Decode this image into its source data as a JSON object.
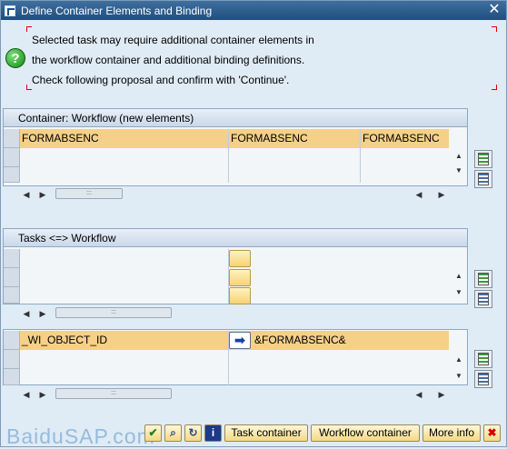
{
  "window": {
    "title": "Define Container Elements and Binding"
  },
  "message": {
    "lines": [
      "Selected task may require additional container elements in",
      "the workflow container and additional binding definitions.",
      "Check following proposal and confirm with 'Continue'."
    ]
  },
  "panel1": {
    "title": "Container: Workflow (new elements)",
    "row1": [
      "FORMABSENC",
      "FORMABSENC",
      "FORMABSENC"
    ]
  },
  "panel2": {
    "title": "Tasks <=> Workflow"
  },
  "panel3": {
    "row1_left": "_WI_OBJECT_ID",
    "row1_right": "&FORMABSENC&"
  },
  "footer": {
    "task_container": "Task container",
    "workflow_container": "Workflow container",
    "more_info": "More info",
    "watermark": "BaiduSAP.com"
  },
  "icons": {
    "help": "help-icon",
    "close": "close-icon",
    "continue": "check-icon",
    "find": "find-icon",
    "refresh": "refresh-icon",
    "info": "info-icon",
    "cancel": "cancel-icon",
    "arrow": "right-arrow-icon"
  },
  "colors": {
    "title_bar": "#1f4f7f",
    "row_highlight": "#f5d088",
    "background": "#dfebf5"
  }
}
